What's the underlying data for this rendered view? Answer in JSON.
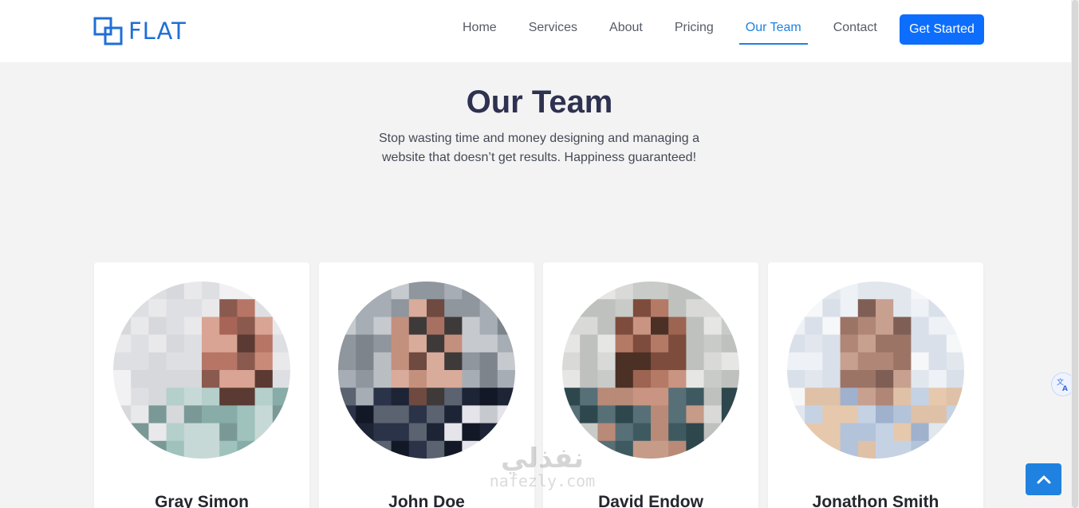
{
  "nav": {
    "logo_text": "FLAT",
    "items": [
      {
        "label": "Home"
      },
      {
        "label": "Services"
      },
      {
        "label": "About"
      },
      {
        "label": "Pricing"
      },
      {
        "label": "Our Team",
        "active": true
      },
      {
        "label": "Contact"
      }
    ],
    "cta_label": "Get Started",
    "accent_color": "#1f82e0",
    "cta_color": "#0d6efd"
  },
  "hero": {
    "title": "Our Team",
    "subtitle": "Stop wasting time and money designing and managing a website that doesn’t get results. Happiness guaranteed!"
  },
  "team": [
    {
      "name": "Gray Simon",
      "photo": "pixelated-portrait"
    },
    {
      "name": "John Doe",
      "photo": "pixelated-portrait"
    },
    {
      "name": "David Endow",
      "photo": "pixelated-portrait"
    },
    {
      "name": "Jonathon Smith",
      "photo": "pixelated-portrait"
    }
  ],
  "watermark": {
    "arabic": "نفذلي",
    "latin": "nafezly.com"
  },
  "icons": {
    "logo": "overlapping-squares-icon",
    "translate": "translate-icon",
    "back_to_top": "chevron-up-icon"
  }
}
